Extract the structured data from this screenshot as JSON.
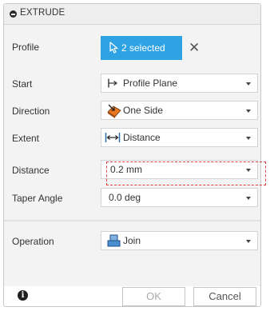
{
  "dialog": {
    "title": "EXTRUDE",
    "collapse_icon": "minus-circle-icon"
  },
  "profile": {
    "label": "Profile",
    "selection_text": "2 selected",
    "selection_icon": "cursor-arrow-icon",
    "clear_icon": "close-icon",
    "clear_glyph": "✕",
    "accent_color": "#2fa2e4"
  },
  "start": {
    "label": "Start",
    "value": "Profile Plane",
    "icon": "profile-plane-icon"
  },
  "direction": {
    "label": "Direction",
    "value": "One Side",
    "icon": "one-side-direction-icon"
  },
  "extent": {
    "label": "Extent",
    "value": "Distance",
    "icon": "distance-extent-icon"
  },
  "distance": {
    "label": "Distance",
    "value": "0.2 mm",
    "highlight_color": "#e23c3c"
  },
  "taper_angle": {
    "label": "Taper Angle",
    "value": "0.0 deg"
  },
  "operation": {
    "label": "Operation",
    "value": "Join",
    "icon": "join-operation-icon"
  },
  "footer": {
    "info_glyph": "i",
    "ok_label": "OK",
    "cancel_label": "Cancel"
  }
}
